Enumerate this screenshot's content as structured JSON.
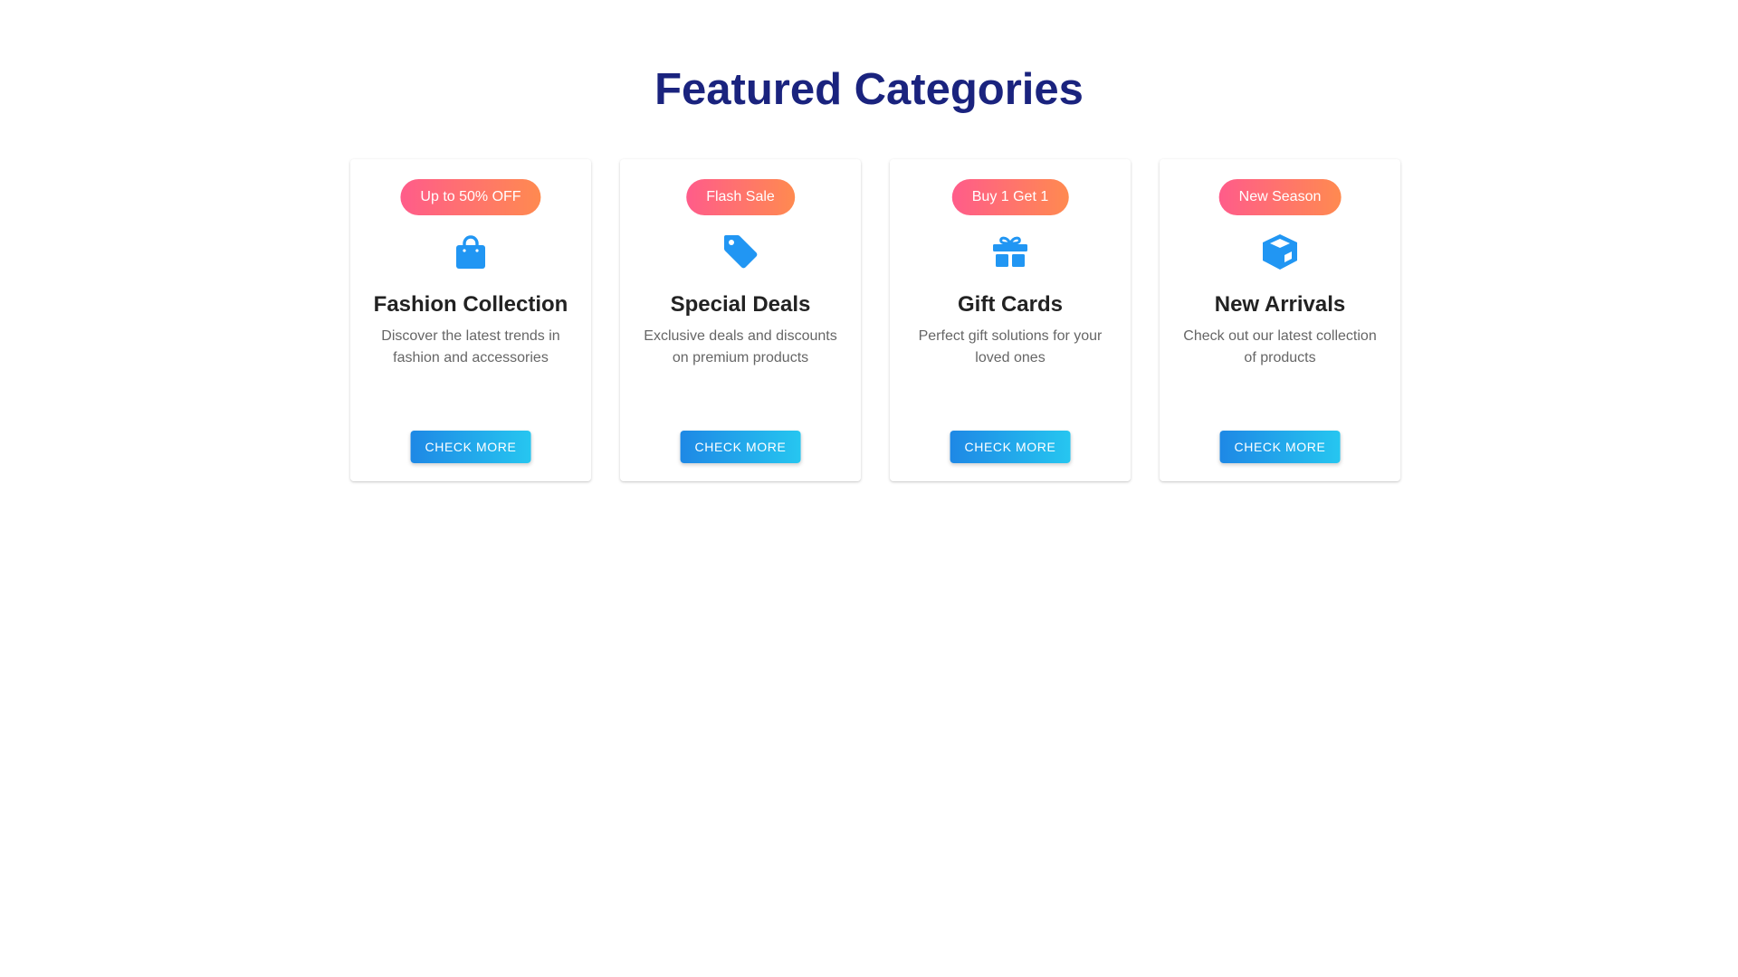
{
  "page": {
    "title": "Featured Categories"
  },
  "colors": {
    "title": "#1a237e",
    "icon": "#2196f3",
    "badge_gradient": [
      "#ff5c8a",
      "#ff8a50"
    ],
    "button_gradient": [
      "#1e88e5",
      "#26c6f0"
    ]
  },
  "cards": [
    {
      "badge": "Up to 50% OFF",
      "icon": "shopping-bag-icon",
      "title": "Fashion Collection",
      "description": "Discover the latest trends in fashion and accessories",
      "button": "Check More"
    },
    {
      "badge": "Flash Sale",
      "icon": "tag-icon",
      "title": "Special Deals",
      "description": "Exclusive deals and discounts on premium products",
      "button": "Check More"
    },
    {
      "badge": "Buy 1 Get 1",
      "icon": "gift-icon",
      "title": "Gift Cards",
      "description": "Perfect gift solutions for your loved ones",
      "button": "Check More"
    },
    {
      "badge": "New Season",
      "icon": "box-icon",
      "title": "New Arrivals",
      "description": "Check out our latest collection of products",
      "button": "Check More"
    }
  ]
}
